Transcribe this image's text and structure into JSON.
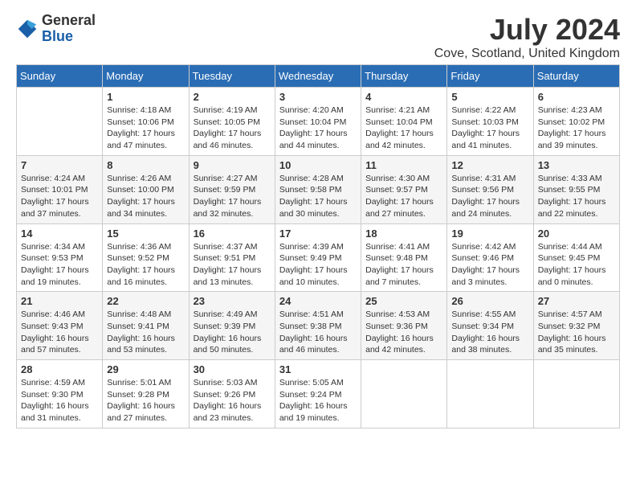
{
  "logo": {
    "general": "General",
    "blue": "Blue"
  },
  "title": "July 2024",
  "subtitle": "Cove, Scotland, United Kingdom",
  "days_of_week": [
    "Sunday",
    "Monday",
    "Tuesday",
    "Wednesday",
    "Thursday",
    "Friday",
    "Saturday"
  ],
  "weeks": [
    [
      {
        "day": "",
        "info": ""
      },
      {
        "day": "1",
        "info": "Sunrise: 4:18 AM\nSunset: 10:06 PM\nDaylight: 17 hours\nand 47 minutes."
      },
      {
        "day": "2",
        "info": "Sunrise: 4:19 AM\nSunset: 10:05 PM\nDaylight: 17 hours\nand 46 minutes."
      },
      {
        "day": "3",
        "info": "Sunrise: 4:20 AM\nSunset: 10:04 PM\nDaylight: 17 hours\nand 44 minutes."
      },
      {
        "day": "4",
        "info": "Sunrise: 4:21 AM\nSunset: 10:04 PM\nDaylight: 17 hours\nand 42 minutes."
      },
      {
        "day": "5",
        "info": "Sunrise: 4:22 AM\nSunset: 10:03 PM\nDaylight: 17 hours\nand 41 minutes."
      },
      {
        "day": "6",
        "info": "Sunrise: 4:23 AM\nSunset: 10:02 PM\nDaylight: 17 hours\nand 39 minutes."
      }
    ],
    [
      {
        "day": "7",
        "info": "Sunrise: 4:24 AM\nSunset: 10:01 PM\nDaylight: 17 hours\nand 37 minutes."
      },
      {
        "day": "8",
        "info": "Sunrise: 4:26 AM\nSunset: 10:00 PM\nDaylight: 17 hours\nand 34 minutes."
      },
      {
        "day": "9",
        "info": "Sunrise: 4:27 AM\nSunset: 9:59 PM\nDaylight: 17 hours\nand 32 minutes."
      },
      {
        "day": "10",
        "info": "Sunrise: 4:28 AM\nSunset: 9:58 PM\nDaylight: 17 hours\nand 30 minutes."
      },
      {
        "day": "11",
        "info": "Sunrise: 4:30 AM\nSunset: 9:57 PM\nDaylight: 17 hours\nand 27 minutes."
      },
      {
        "day": "12",
        "info": "Sunrise: 4:31 AM\nSunset: 9:56 PM\nDaylight: 17 hours\nand 24 minutes."
      },
      {
        "day": "13",
        "info": "Sunrise: 4:33 AM\nSunset: 9:55 PM\nDaylight: 17 hours\nand 22 minutes."
      }
    ],
    [
      {
        "day": "14",
        "info": "Sunrise: 4:34 AM\nSunset: 9:53 PM\nDaylight: 17 hours\nand 19 minutes."
      },
      {
        "day": "15",
        "info": "Sunrise: 4:36 AM\nSunset: 9:52 PM\nDaylight: 17 hours\nand 16 minutes."
      },
      {
        "day": "16",
        "info": "Sunrise: 4:37 AM\nSunset: 9:51 PM\nDaylight: 17 hours\nand 13 minutes."
      },
      {
        "day": "17",
        "info": "Sunrise: 4:39 AM\nSunset: 9:49 PM\nDaylight: 17 hours\nand 10 minutes."
      },
      {
        "day": "18",
        "info": "Sunrise: 4:41 AM\nSunset: 9:48 PM\nDaylight: 17 hours\nand 7 minutes."
      },
      {
        "day": "19",
        "info": "Sunrise: 4:42 AM\nSunset: 9:46 PM\nDaylight: 17 hours\nand 3 minutes."
      },
      {
        "day": "20",
        "info": "Sunrise: 4:44 AM\nSunset: 9:45 PM\nDaylight: 17 hours\nand 0 minutes."
      }
    ],
    [
      {
        "day": "21",
        "info": "Sunrise: 4:46 AM\nSunset: 9:43 PM\nDaylight: 16 hours\nand 57 minutes."
      },
      {
        "day": "22",
        "info": "Sunrise: 4:48 AM\nSunset: 9:41 PM\nDaylight: 16 hours\nand 53 minutes."
      },
      {
        "day": "23",
        "info": "Sunrise: 4:49 AM\nSunset: 9:39 PM\nDaylight: 16 hours\nand 50 minutes."
      },
      {
        "day": "24",
        "info": "Sunrise: 4:51 AM\nSunset: 9:38 PM\nDaylight: 16 hours\nand 46 minutes."
      },
      {
        "day": "25",
        "info": "Sunrise: 4:53 AM\nSunset: 9:36 PM\nDaylight: 16 hours\nand 42 minutes."
      },
      {
        "day": "26",
        "info": "Sunrise: 4:55 AM\nSunset: 9:34 PM\nDaylight: 16 hours\nand 38 minutes."
      },
      {
        "day": "27",
        "info": "Sunrise: 4:57 AM\nSunset: 9:32 PM\nDaylight: 16 hours\nand 35 minutes."
      }
    ],
    [
      {
        "day": "28",
        "info": "Sunrise: 4:59 AM\nSunset: 9:30 PM\nDaylight: 16 hours\nand 31 minutes."
      },
      {
        "day": "29",
        "info": "Sunrise: 5:01 AM\nSunset: 9:28 PM\nDaylight: 16 hours\nand 27 minutes."
      },
      {
        "day": "30",
        "info": "Sunrise: 5:03 AM\nSunset: 9:26 PM\nDaylight: 16 hours\nand 23 minutes."
      },
      {
        "day": "31",
        "info": "Sunrise: 5:05 AM\nSunset: 9:24 PM\nDaylight: 16 hours\nand 19 minutes."
      },
      {
        "day": "",
        "info": ""
      },
      {
        "day": "",
        "info": ""
      },
      {
        "day": "",
        "info": ""
      }
    ]
  ]
}
